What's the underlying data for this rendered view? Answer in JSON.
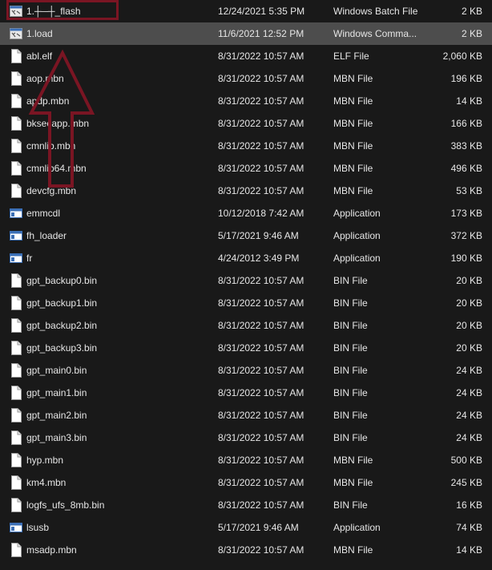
{
  "accent": {
    "selected_row": "#4d4d4d",
    "annotation": "#7a1523",
    "text": "#e6e6e6"
  },
  "files": [
    {
      "name": "1.┼─┼_flash",
      "date": "12/24/2021 5:35 PM",
      "type": "Windows Batch File",
      "size": "2 KB",
      "icon": "batch-file-icon"
    },
    {
      "name": "1.load",
      "date": "11/6/2021 12:52 PM",
      "type": "Windows Comma...",
      "size": "2 KB",
      "icon": "batch-file-icon",
      "selected": true
    },
    {
      "name": "abl.elf",
      "date": "8/31/2022 10:57 AM",
      "type": "ELF File",
      "size": "2,060 KB",
      "icon": "file-icon"
    },
    {
      "name": "aop.mbn",
      "date": "8/31/2022 10:57 AM",
      "type": "MBN File",
      "size": "196 KB",
      "icon": "file-icon"
    },
    {
      "name": "apdp.mbn",
      "date": "8/31/2022 10:57 AM",
      "type": "MBN File",
      "size": "14 KB",
      "icon": "file-icon"
    },
    {
      "name": "bksecapp.mbn",
      "date": "8/31/2022 10:57 AM",
      "type": "MBN File",
      "size": "166 KB",
      "icon": "file-icon"
    },
    {
      "name": "cmnlib.mbn",
      "date": "8/31/2022 10:57 AM",
      "type": "MBN File",
      "size": "383 KB",
      "icon": "file-icon"
    },
    {
      "name": "cmnlib64.mbn",
      "date": "8/31/2022 10:57 AM",
      "type": "MBN File",
      "size": "496 KB",
      "icon": "file-icon"
    },
    {
      "name": "devcfg.mbn",
      "date": "8/31/2022 10:57 AM",
      "type": "MBN File",
      "size": "53 KB",
      "icon": "file-icon"
    },
    {
      "name": "emmcdl",
      "date": "10/12/2018 7:42 AM",
      "type": "Application",
      "size": "173 KB",
      "icon": "application-icon"
    },
    {
      "name": "fh_loader",
      "date": "5/17/2021 9:46 AM",
      "type": "Application",
      "size": "372 KB",
      "icon": "application-icon"
    },
    {
      "name": "fr",
      "date": "4/24/2012 3:49 PM",
      "type": "Application",
      "size": "190 KB",
      "icon": "application-icon"
    },
    {
      "name": "gpt_backup0.bin",
      "date": "8/31/2022 10:57 AM",
      "type": "BIN File",
      "size": "20 KB",
      "icon": "file-icon"
    },
    {
      "name": "gpt_backup1.bin",
      "date": "8/31/2022 10:57 AM",
      "type": "BIN File",
      "size": "20 KB",
      "icon": "file-icon"
    },
    {
      "name": "gpt_backup2.bin",
      "date": "8/31/2022 10:57 AM",
      "type": "BIN File",
      "size": "20 KB",
      "icon": "file-icon"
    },
    {
      "name": "gpt_backup3.bin",
      "date": "8/31/2022 10:57 AM",
      "type": "BIN File",
      "size": "20 KB",
      "icon": "file-icon"
    },
    {
      "name": "gpt_main0.bin",
      "date": "8/31/2022 10:57 AM",
      "type": "BIN File",
      "size": "24 KB",
      "icon": "file-icon"
    },
    {
      "name": "gpt_main1.bin",
      "date": "8/31/2022 10:57 AM",
      "type": "BIN File",
      "size": "24 KB",
      "icon": "file-icon"
    },
    {
      "name": "gpt_main2.bin",
      "date": "8/31/2022 10:57 AM",
      "type": "BIN File",
      "size": "24 KB",
      "icon": "file-icon"
    },
    {
      "name": "gpt_main3.bin",
      "date": "8/31/2022 10:57 AM",
      "type": "BIN File",
      "size": "24 KB",
      "icon": "file-icon"
    },
    {
      "name": "hyp.mbn",
      "date": "8/31/2022 10:57 AM",
      "type": "MBN File",
      "size": "500 KB",
      "icon": "file-icon"
    },
    {
      "name": "km4.mbn",
      "date": "8/31/2022 10:57 AM",
      "type": "MBN File",
      "size": "245 KB",
      "icon": "file-icon"
    },
    {
      "name": "logfs_ufs_8mb.bin",
      "date": "8/31/2022 10:57 AM",
      "type": "BIN File",
      "size": "16 KB",
      "icon": "file-icon"
    },
    {
      "name": "lsusb",
      "date": "5/17/2021 9:46 AM",
      "type": "Application",
      "size": "74 KB",
      "icon": "application-icon"
    },
    {
      "name": "msadp.mbn",
      "date": "8/31/2022 10:57 AM",
      "type": "MBN File",
      "size": "14 KB",
      "icon": "file-icon"
    }
  ]
}
